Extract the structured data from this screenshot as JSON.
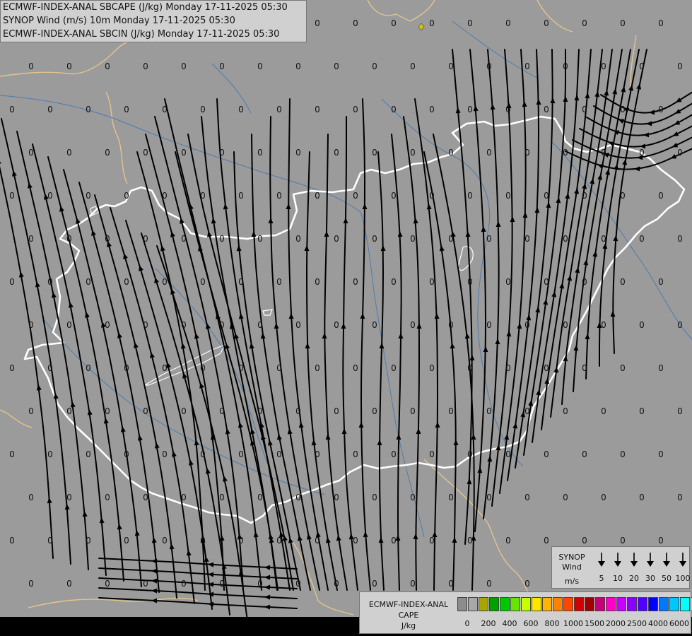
{
  "header": {
    "line1": "ECMWF-INDEX-ANAL SBCAPE (J/kg) Monday 17-11-2025 05:30",
    "line2": "SYNOP Wind (m/s) 10m Monday 17-11-2025 05:30",
    "line3": "ECMWF-INDEX-ANAL SBCIN (J/kg) Monday 17-11-2025 05:30"
  },
  "colors": {
    "background": "#9b9b9b",
    "country_border": "#ffffff",
    "neighbor_border": "#e3c48d",
    "rivers": "#4d7cae",
    "streamlines": "#000000",
    "value_text": "#111111",
    "synop_marker": "#d4c400"
  },
  "grid_value": "0",
  "synop_legend": {
    "title": "SYNOP Wind",
    "units": "m/s",
    "speeds": [
      "5",
      "10",
      "20",
      "30",
      "50",
      "100"
    ]
  },
  "cape_legend": {
    "title_line1": "ECMWF-INDEX-ANAL",
    "title_line2": "CAPE",
    "units": "J/kg",
    "colors": [
      "#8c8c8c",
      "#a8a8a8",
      "#a8a400",
      "#00a000",
      "#00c800",
      "#64e600",
      "#c8ff00",
      "#ffe600",
      "#ffb400",
      "#ff8200",
      "#ff4600",
      "#d20000",
      "#a00000",
      "#c80078",
      "#ff00c8",
      "#c800ff",
      "#8c00ff",
      "#5000ff",
      "#0000ff",
      "#0078ff",
      "#00c8ff",
      "#00ffff",
      "#c8ffff",
      "#ffffff"
    ],
    "labels": [
      "0",
      "200",
      "400",
      "600",
      "800",
      "1000",
      "1500",
      "2000",
      "2500",
      "4000",
      "6000"
    ]
  }
}
